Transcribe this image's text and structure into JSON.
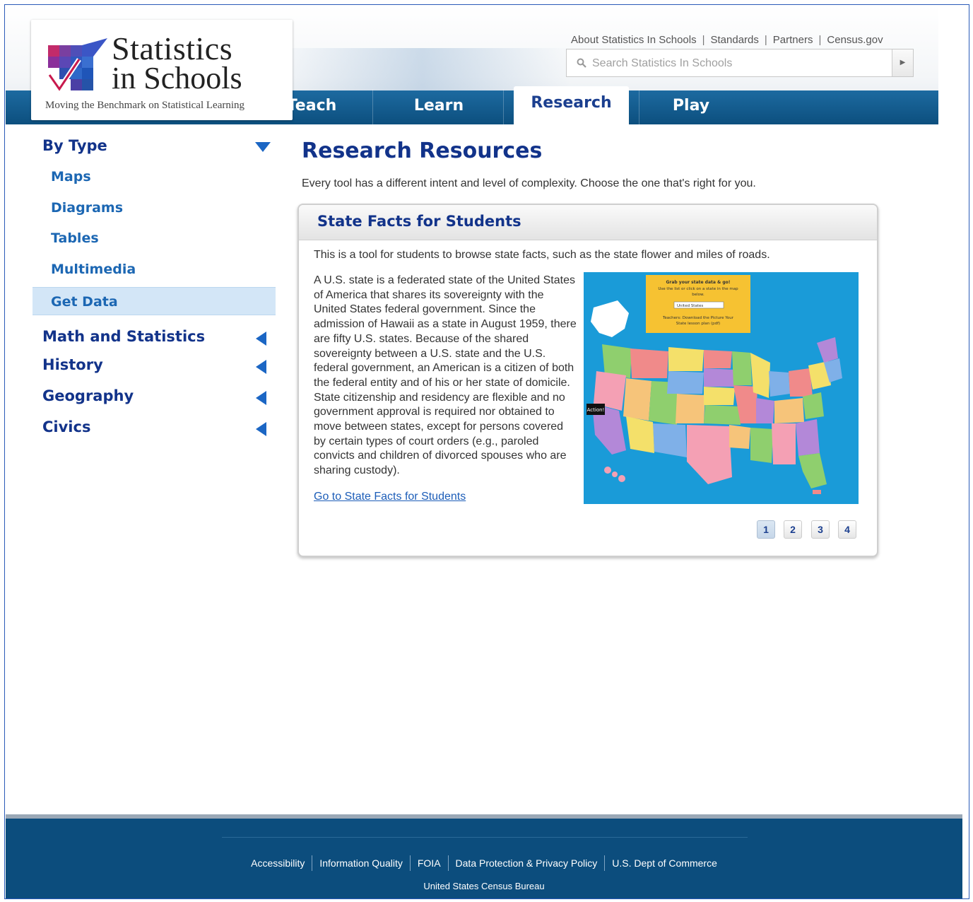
{
  "brand": {
    "title": "Statistics",
    "subtitle": "in Schools",
    "tagline": "Moving the Benchmark on Statistical Learning"
  },
  "utility_nav": [
    "About Statistics In Schools",
    "Standards",
    "Partners",
    "Census.gov"
  ],
  "search": {
    "placeholder": "Search Statistics In Schools"
  },
  "tabs": [
    {
      "label": "Teach",
      "active": false
    },
    {
      "label": "Learn",
      "active": false
    },
    {
      "label": "Research",
      "active": true
    },
    {
      "label": "Play",
      "active": false
    }
  ],
  "sidebar": {
    "by_type": {
      "label": "By Type",
      "items": [
        "Maps",
        "Diagrams",
        "Tables",
        "Multimedia",
        "Get Data"
      ],
      "active": "Get Data"
    },
    "sections": [
      "Math and Statistics",
      "History",
      "Geography",
      "Civics"
    ]
  },
  "main": {
    "title": "Research Resources",
    "intro": "Every tool has a different intent and level of complexity. Choose the one that's right for you.",
    "card": {
      "title": "State Facts for Students",
      "description": "This is a tool for students to browse state facts, such as the state flower and miles of roads.",
      "body": "A U.S. state is a federated state of the United States of America that shares its sovereignty with the United States federal government. Since the admission of Hawaii as a state in August 1959, there are fifty U.S. states. Because of the shared sovereignty between a U.S. state and the U.S. federal government, an American is a citizen of both the federal entity and of his or her state of domicile. State citizenship and residency are flexible and no government approval is required nor obtained to move between states, except for persons covered by certain types of court orders (e.g., paroled convicts and children of divorced spouses who are sharing custody).",
      "link": "Go to State Facts for Students",
      "map_caption": "Grab your state data & go! Use the list or click on a state in the map below.",
      "map_select": "United States",
      "map_teacher": "Teachers: Download the Picture Your State lesson plan (pdf)",
      "map_badge": "Action!"
    },
    "pagination": {
      "pages": [
        "1",
        "2",
        "3",
        "4"
      ],
      "current": "1"
    }
  },
  "footer": {
    "links": [
      "Accessibility",
      "Information Quality",
      "FOIA",
      "Data Protection & Privacy Policy",
      "U.S. Dept of Commerce"
    ],
    "agency": "United States Census Bureau"
  },
  "colors": {
    "brand_blue": "#12338a",
    "link_blue": "#1c67b3",
    "header_band": "#0c4f7e",
    "active_side": "#d3e6f7",
    "footer_bg": "#0c4d7d",
    "map_water": "#1a9bd8"
  }
}
